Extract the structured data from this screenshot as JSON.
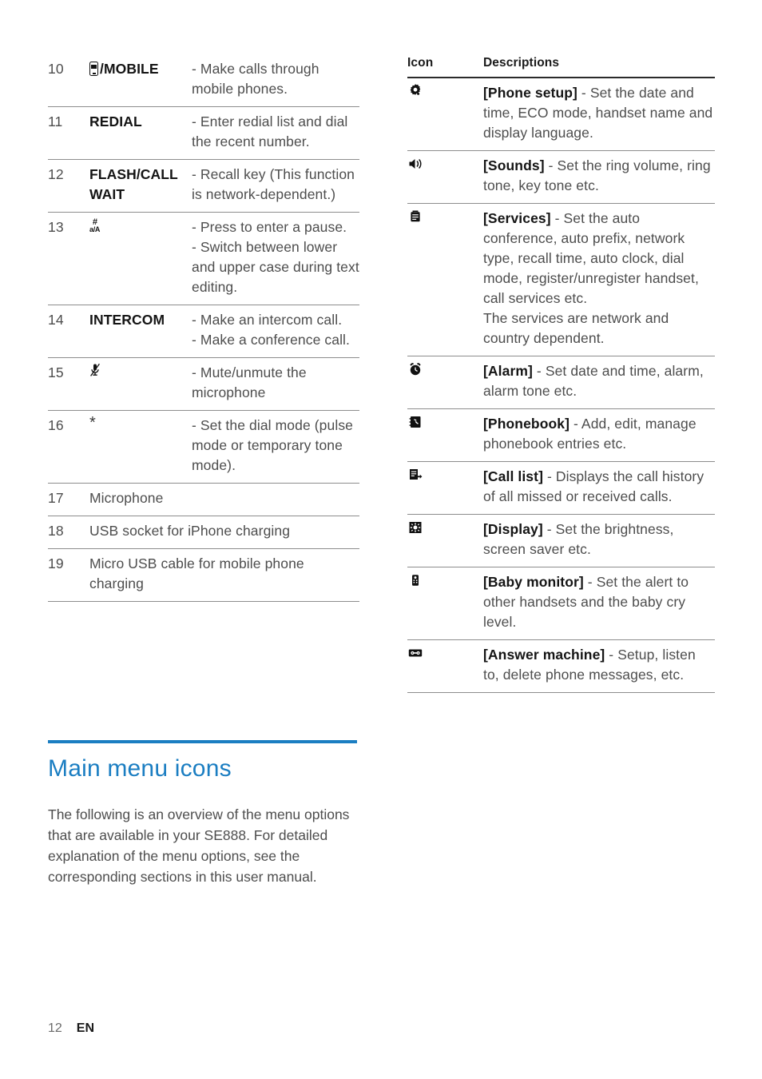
{
  "left_table": {
    "rows": [
      {
        "num": "10",
        "key": "/MOBILE",
        "key_icon": "mobile-phone-icon",
        "key_bold": true,
        "desc": "- Make calls through mobile phones."
      },
      {
        "num": "11",
        "key": "REDIAL",
        "key_bold": true,
        "desc": "- Enter redial list and dial the recent number."
      },
      {
        "num": "12",
        "key": "FLASH/CALL WAIT",
        "key_bold": true,
        "desc": "- Recall key (This function is network-dependent.)"
      },
      {
        "num": "13",
        "key": "",
        "key_icon": "hash-case-switch-icon",
        "key_icon_top": "#",
        "key_icon_bottom": "a/A",
        "desc": "- Press to enter a pause.\n- Switch between lower and upper case during text editing."
      },
      {
        "num": "14",
        "key": "INTERCOM",
        "key_bold": true,
        "desc": "- Make an intercom call.\n- Make a conference call."
      },
      {
        "num": "15",
        "key": "",
        "key_icon": "mute-microphone-icon",
        "desc": "- Mute/unmute the microphone"
      },
      {
        "num": "16",
        "key": "",
        "key_icon": "asterisk-icon",
        "desc": "- Set the dial mode (pulse mode or temporary tone mode)."
      },
      {
        "num": "17",
        "key": "Microphone",
        "key_bold": false,
        "span": true,
        "desc": ""
      },
      {
        "num": "18",
        "key": "USB socket for iPhone charging",
        "key_bold": false,
        "span": true,
        "desc": ""
      },
      {
        "num": "19",
        "key": "Micro USB cable for mobile phone charging",
        "key_bold": false,
        "span": true,
        "desc": ""
      }
    ]
  },
  "right_table": {
    "headers": {
      "icon": "Icon",
      "descriptions": "Descriptions"
    },
    "rows": [
      {
        "icon": "gear-icon",
        "label": "[Phone setup]",
        "desc": " - Set the date and time, ECO mode, handset name and display language."
      },
      {
        "icon": "speaker-icon",
        "label": "[Sounds]",
        "desc": " - Set the ring volume, ring tone, key tone etc."
      },
      {
        "icon": "briefcase-icon",
        "label": "[Services]",
        "desc": " - Set the auto conference, auto prefix, network type, recall time, auto clock, dial mode, register/unregister handset, call services etc.\nThe services are network and country dependent."
      },
      {
        "icon": "alarm-clock-icon",
        "label": "[Alarm]",
        "desc": " - Set date and time, alarm, alarm tone etc."
      },
      {
        "icon": "phonebook-icon",
        "label": "[Phonebook]",
        "desc": " - Add, edit, manage phonebook entries etc."
      },
      {
        "icon": "call-list-icon",
        "label": "[Call list]",
        "desc": " - Displays the call history of all missed or received calls."
      },
      {
        "icon": "display-brightness-icon",
        "label": "[Display]",
        "desc": " - Set the brightness, screen saver etc."
      },
      {
        "icon": "baby-monitor-icon",
        "label": "[Baby monitor]",
        "desc": " - Set the alert to other handsets and the baby cry level."
      },
      {
        "icon": "answer-machine-icon",
        "label": "[Answer machine]",
        "desc": " - Setup, listen to, delete phone messages, etc."
      }
    ]
  },
  "section": {
    "title": "Main menu icons",
    "body": "The following is an overview of the menu options that are available in your SE888. For detailed explanation of the menu options, see the corresponding sections in this user manual."
  },
  "footer": {
    "page_number": "12",
    "language": "EN"
  },
  "colors": {
    "accent_blue": "#1b7ec2",
    "body_text": "#4d4d4d",
    "bold_text": "#141414",
    "rule": "#8d8d8d"
  }
}
